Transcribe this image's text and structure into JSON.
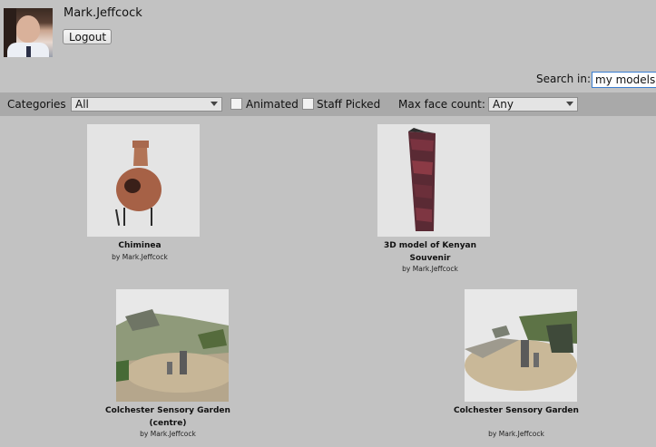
{
  "user": {
    "name": "Mark.Jeffcock",
    "logout_label": "Logout"
  },
  "search": {
    "label": "Search in:",
    "value": "my models"
  },
  "filters": {
    "categories_label": "Categories",
    "categories_value": "All",
    "animated_label": "Animated",
    "staff_picked_label": "Staff Picked",
    "max_face_label": "Max face count:",
    "max_face_value": "Any"
  },
  "models": [
    {
      "title": "Chiminea",
      "author": "by Mark.Jeffcock"
    },
    {
      "title": "3D model of Kenyan Souvenir",
      "author": "by Mark.Jeffcock"
    },
    {
      "title": "Colchester Sensory Garden (centre)",
      "author": "by Mark.Jeffcock"
    },
    {
      "title": "Colchester Sensory Garden",
      "author": "by Mark.Jeffcock"
    }
  ]
}
